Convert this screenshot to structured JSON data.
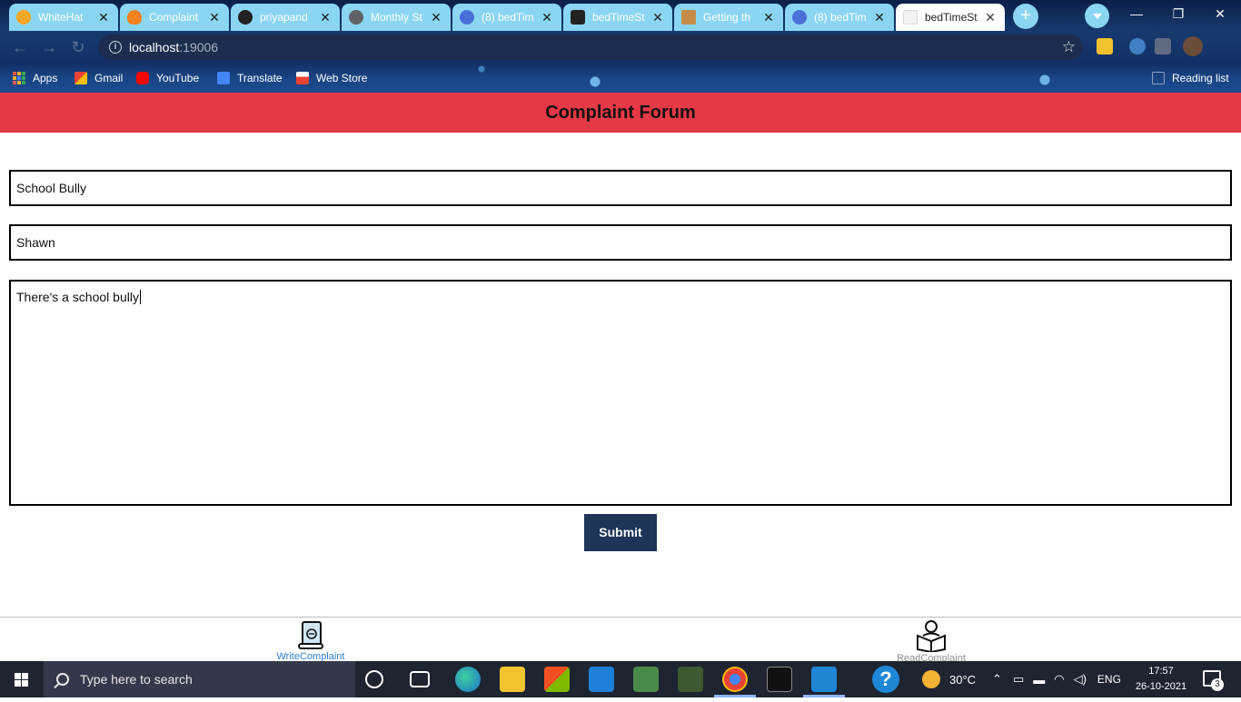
{
  "browser": {
    "tabs": [
      {
        "title": "WhiteHat",
        "favicon_color": "#f5a623"
      },
      {
        "title": "Complaint",
        "favicon_color": "#f6821f"
      },
      {
        "title": "priyapand",
        "favicon_color": "#222222"
      },
      {
        "title": "Monthly St",
        "favicon_color": "#5f6368"
      },
      {
        "title": "(8) bedTim",
        "favicon_color": "#4a6fd8"
      },
      {
        "title": "bedTimeSt",
        "favicon_color": "#222222"
      },
      {
        "title": "Getting th",
        "favicon_color": "#c58b47"
      },
      {
        "title": "(8) bedTim",
        "favicon_color": "#4a6fd8"
      },
      {
        "title": "bedTimeSt",
        "favicon_color": "#f1f3f4"
      }
    ],
    "tab_close_glyph": "✕",
    "new_tab_glyph": "+",
    "url_host": "localhost",
    "url_port": ":19006",
    "bookmarks": [
      {
        "label": "Apps",
        "icon": "apps-grid-icon"
      },
      {
        "label": "Gmail",
        "icon": "gmail-icon"
      },
      {
        "label": "YouTube",
        "icon": "youtube-icon"
      },
      {
        "label": "Translate",
        "icon": "translate-icon"
      },
      {
        "label": "Web Store",
        "icon": "web-store-icon"
      }
    ],
    "reading_list": "Reading list"
  },
  "app": {
    "header_title": "Complaint Forum",
    "form": {
      "title_value": "School Bully",
      "author_value": "Shawn",
      "story_value": "There's a school bully",
      "submit_label": "Submit"
    },
    "bottom_nav": [
      {
        "label": "WriteComplaint",
        "active": true,
        "icon": "scroll-write-icon"
      },
      {
        "label": "ReadComplaint",
        "active": false,
        "icon": "reading-person-icon"
      }
    ]
  },
  "taskbar": {
    "search_placeholder": "Type here to search",
    "weather_temp": "30°C",
    "language": "ENG",
    "time": "17:57",
    "date": "26-10-2021",
    "notification_count": "3"
  },
  "colors": {
    "header_red": "#e63946",
    "submit_navy": "#1d3557",
    "active_nav_blue": "#2f80d8"
  }
}
